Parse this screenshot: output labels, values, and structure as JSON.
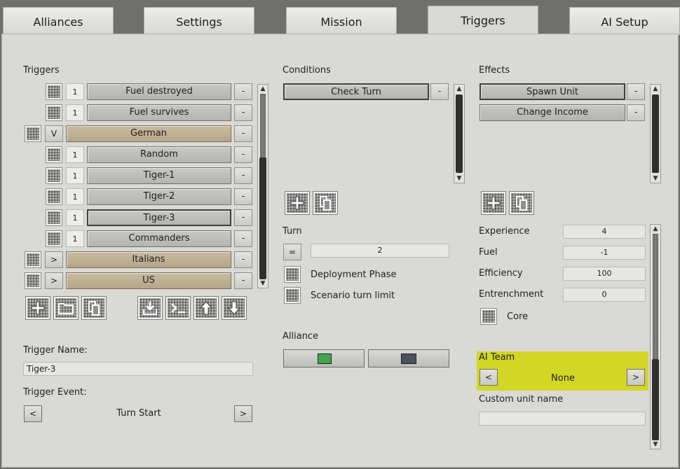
{
  "tabs": [
    "Alliances",
    "Settings",
    "Mission",
    "Triggers",
    "AI Setup"
  ],
  "active_tab": "Triggers",
  "triggers": {
    "title": "Triggers",
    "items": [
      {
        "count": "1",
        "label": "Fuel destroyed",
        "group": false
      },
      {
        "count": "1",
        "label": "Fuel survives",
        "group": false
      },
      {
        "count": "V",
        "label": "German",
        "group": true
      },
      {
        "count": "1",
        "label": "Random",
        "group": false
      },
      {
        "count": "1",
        "label": "Tiger-1",
        "group": false
      },
      {
        "count": "1",
        "label": "Tiger-2",
        "group": false
      },
      {
        "count": "1",
        "label": "Tiger-3",
        "group": false,
        "selected": true
      },
      {
        "count": "1",
        "label": "Commanders",
        "group": false
      },
      {
        "count": ">",
        "label": "Italians",
        "group": true
      },
      {
        "count": ">",
        "label": "US",
        "group": true
      }
    ],
    "remove_label": "-",
    "name_label": "Trigger Name:",
    "name_value": "Tiger-3",
    "event_label": "Trigger Event:",
    "event_value": "Turn Start",
    "prev": "<",
    "next": ">"
  },
  "conditions": {
    "title": "Conditions",
    "items": [
      "Check Turn"
    ],
    "turn_label": "Turn",
    "turn_operator": "=",
    "turn_value": "2",
    "deployment_phase": "Deployment Phase",
    "scenario_turn_limit": "Scenario turn limit",
    "alliance_label": "Alliance",
    "alliance_colors": [
      "#3fa74f",
      "#4a535c"
    ]
  },
  "effects": {
    "title": "Effects",
    "items": [
      "Spawn Unit",
      "Change Income"
    ],
    "experience_label": "Experience",
    "experience_value": "4",
    "fuel_label": "Fuel",
    "fuel_value": "-1",
    "efficiency_label": "Efficiency",
    "efficiency_value": "100",
    "entrenchment_label": "Entrenchment",
    "entrenchment_value": "0",
    "core_label": "Core",
    "ai_team_label": "AI Team",
    "ai_team_value": "None",
    "ai_team_highlight": "#d4d626",
    "custom_unit_label": "Custom unit name",
    "custom_unit_value": ""
  }
}
